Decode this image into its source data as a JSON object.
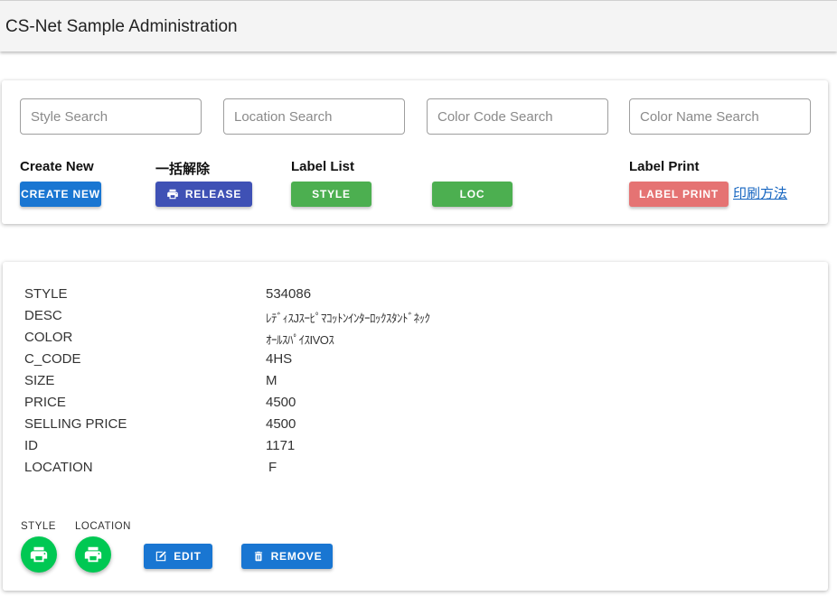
{
  "appbar": {
    "title": "CS-Net Sample Administration"
  },
  "search": {
    "style_placeholder": "Style Search",
    "location_placeholder": "Location Search",
    "color_code_placeholder": "Color Code Search",
    "color_name_placeholder": "Color Name Search"
  },
  "toolbar": {
    "create_label": "Create New",
    "create_button": "CREATE NEW",
    "release_label": "一括解除",
    "release_button": "RELEASE",
    "label_list_label": "Label List",
    "style_button": "STYLE",
    "loc_button": "LOC",
    "label_print_label": "Label Print",
    "label_print_button": "LABEL PRINT",
    "print_method_link": "印刷方法"
  },
  "detail": {
    "rows": [
      {
        "key": "STYLE",
        "value": "534086"
      },
      {
        "key": "DESC",
        "value": "ﾚﾃﾞｨｽJｽｰﾋﾟﾏｺｯﾄﾝｲﾝﾀｰﾛｯｸｽﾀﾝﾄﾞﾈｯｸ"
      },
      {
        "key": "COLOR",
        "value": "ｵｰﾙｽﾊﾟｲｽIVOｽ"
      },
      {
        "key": "C_CODE",
        "value": "4HS"
      },
      {
        "key": "SIZE",
        "value": "M"
      },
      {
        "key": "PRICE",
        "value": "4500"
      },
      {
        "key": "SELLING PRICE",
        "value": "4500"
      },
      {
        "key": "ID",
        "value": "1171"
      },
      {
        "key": "LOCATION",
        "value": " F"
      }
    ],
    "style_fab_label": "STYLE",
    "location_fab_label": "LOCATION",
    "edit_button": "EDIT",
    "remove_button": "REMOVE"
  },
  "colors": {
    "primary_blue": "#1976d2",
    "indigo": "#3f51b5",
    "green": "#4caf50",
    "label_print_red": "#e57373",
    "fab_green": "#00c853"
  },
  "icons": [
    "printer-icon",
    "edit-icon",
    "trash-icon"
  ]
}
